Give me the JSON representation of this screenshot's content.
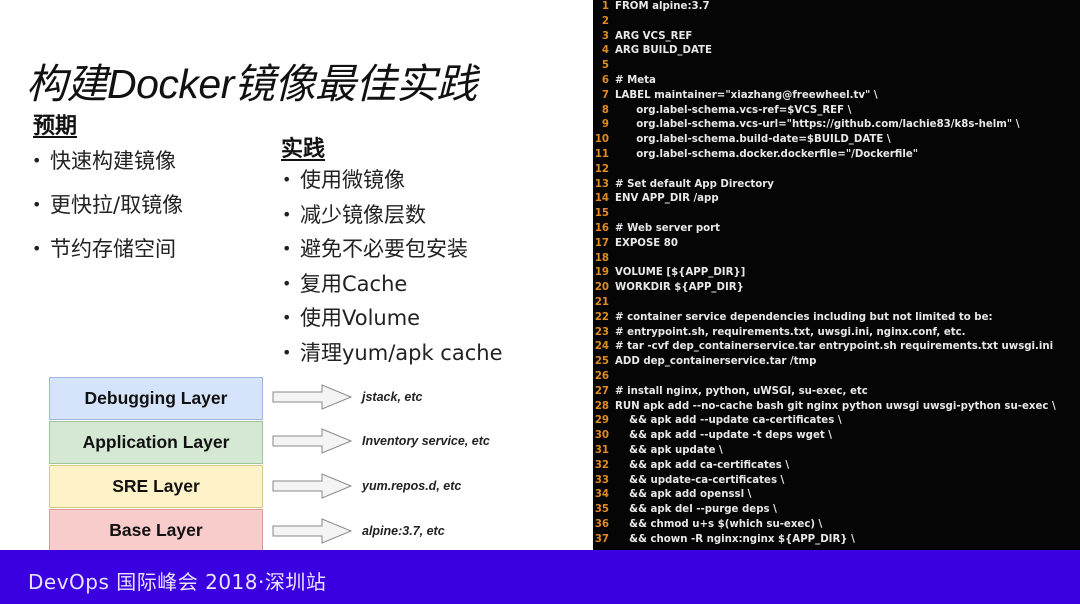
{
  "slide": {
    "title": "构建Docker镜像最佳实践",
    "expect": {
      "heading": "预期",
      "items": [
        "快速构建镜像",
        "更快拉/取镜像",
        "节约存储空间"
      ]
    },
    "practice": {
      "heading": "实践",
      "items": [
        "使用微镜像",
        "减少镜像层数",
        "避免不必要包安装",
        "复用Cache",
        "使用Volume",
        "清理yum/apk cache"
      ]
    },
    "bullet_glyph": "•",
    "layers": [
      {
        "label": "Debugging Layer",
        "color": "#d6e4fb",
        "border": "#9fb6dc",
        "note": "jstack, etc"
      },
      {
        "label": "Application Layer",
        "color": "#d5e8d4",
        "border": "#9fc59b",
        "note": "Inventory service, etc"
      },
      {
        "label": "SRE Layer",
        "color": "#fdf2c8",
        "border": "#d9c98a",
        "note": "yum.repos.d, etc"
      },
      {
        "label": "Base Layer",
        "color": "#f9cccc",
        "border": "#d89a9a",
        "note": "alpine:3.7, etc"
      }
    ],
    "arrow_icon": "right-arrow-icon"
  },
  "code": {
    "lines": [
      {
        "n": "1",
        "t": "FROM alpine:3.7"
      },
      {
        "n": "2",
        "t": ""
      },
      {
        "n": "3",
        "t": "ARG VCS_REF"
      },
      {
        "n": "4",
        "t": "ARG BUILD_DATE"
      },
      {
        "n": "5",
        "t": ""
      },
      {
        "n": "6",
        "t": "# Meta"
      },
      {
        "n": "7",
        "t": "LABEL maintainer=\"xiazhang@freewheel.tv\" \\"
      },
      {
        "n": "8",
        "t": "      org.label-schema.vcs-ref=$VCS_REF \\"
      },
      {
        "n": "9",
        "t": "      org.label-schema.vcs-url=\"https://github.com/lachie83/k8s-helm\" \\"
      },
      {
        "n": "10",
        "t": "      org.label-schema.build-date=$BUILD_DATE \\"
      },
      {
        "n": "11",
        "t": "      org.label-schema.docker.dockerfile=\"/Dockerfile\""
      },
      {
        "n": "12",
        "t": ""
      },
      {
        "n": "13",
        "t": "# Set default App Directory"
      },
      {
        "n": "14",
        "t": "ENV APP_DIR /app"
      },
      {
        "n": "15",
        "t": ""
      },
      {
        "n": "16",
        "t": "# Web server port"
      },
      {
        "n": "17",
        "t": "EXPOSE 80"
      },
      {
        "n": "18",
        "t": ""
      },
      {
        "n": "19",
        "t": "VOLUME [${APP_DIR}]"
      },
      {
        "n": "20",
        "t": "WORKDIR ${APP_DIR}"
      },
      {
        "n": "21",
        "t": ""
      },
      {
        "n": "22",
        "t": "# container service dependencies including but not limited to be:"
      },
      {
        "n": "23",
        "t": "# entrypoint.sh, requirements.txt, uwsgi.ini, nginx.conf, etc."
      },
      {
        "n": "24",
        "t": "# tar -cvf dep_containerservice.tar entrypoint.sh requirements.txt uwsgi.ini"
      },
      {
        "n": "25",
        "t": "ADD dep_containerservice.tar /tmp"
      },
      {
        "n": "26",
        "t": ""
      },
      {
        "n": "27",
        "t": "# install nginx, python, uWSGI, su-exec, etc"
      },
      {
        "n": "28",
        "t": "RUN apk add --no-cache bash git nginx python uwsgi uwsgi-python su-exec \\"
      },
      {
        "n": "29",
        "t": "    && apk add --update ca-certificates \\"
      },
      {
        "n": "30",
        "t": "    && apk add --update -t deps wget \\"
      },
      {
        "n": "31",
        "t": "    && apk update \\"
      },
      {
        "n": "32",
        "t": "    && apk add ca-certificates \\"
      },
      {
        "n": "33",
        "t": "    && update-ca-certificates \\"
      },
      {
        "n": "34",
        "t": "    && apk add openssl \\"
      },
      {
        "n": "35",
        "t": "    && apk del --purge deps \\"
      },
      {
        "n": "36",
        "t": "    && chmod u+s $(which su-exec) \\"
      },
      {
        "n": "37",
        "t": "    && chown -R nginx:nginx ${APP_DIR} \\"
      }
    ]
  },
  "footer": {
    "text": "DevOps 国际峰会 2018·深圳站",
    "color": "#3a00e0"
  }
}
